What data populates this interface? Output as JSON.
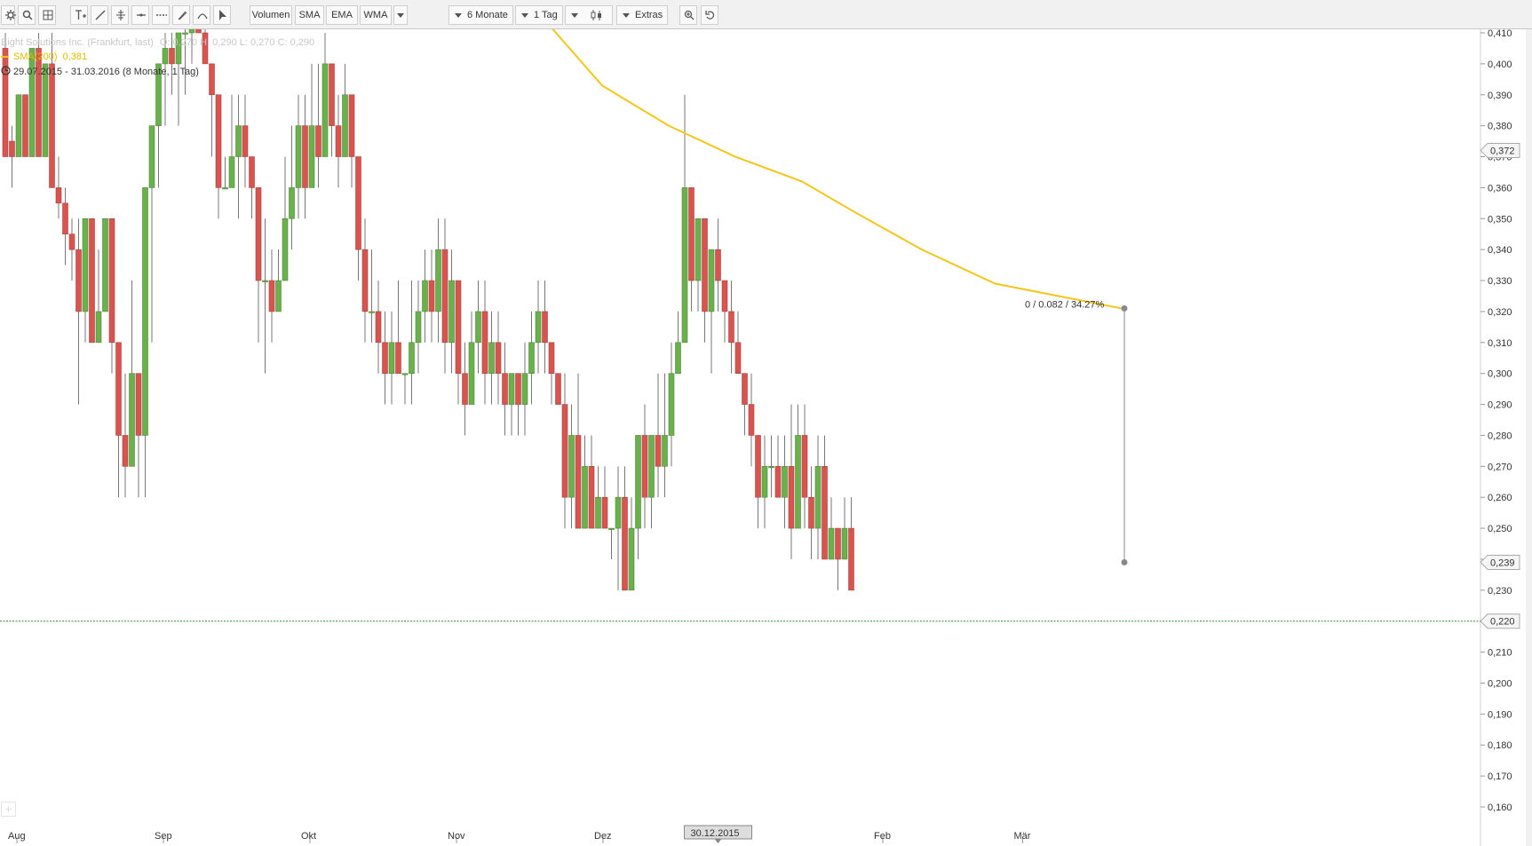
{
  "toolbar": {
    "icons": [
      "settings-icon",
      "search-icon",
      "grid-icon",
      "text-tool-icon",
      "line-tool-icon",
      "crosshair-icon",
      "horizontal-line-icon",
      "dotted-line-icon",
      "pencil-icon",
      "arc-tool-icon",
      "cursor-icon",
      "zoom-icon",
      "undo-icon"
    ],
    "indicator_buttons": [
      "Volumen",
      "SMA",
      "EMA",
      "WMA"
    ],
    "range_label": "6 Monate",
    "interval_label": "1 Tag",
    "extras_label": "Extras"
  },
  "legend": {
    "instrument": "Eight Solutions Inc. (Frankfurt, last)",
    "ohlc": "O: 0,270  H: 0,290  L: 0,270  C: 0,290",
    "sma_label": "SMA(200)",
    "sma_value": "0,381",
    "period": "29.07.2015 - 31.03.2016 (8 Monate, 1 Tag)"
  },
  "colors": {
    "up": "#6ab04c",
    "down": "#d9534f",
    "sma": "#f5c518",
    "baseline": "#2e8b3a",
    "wick": "#777777"
  },
  "chart_data": {
    "type": "candlestick",
    "title": "Eight Solutions Inc. (Frankfurt, last)",
    "ylim": [
      0.16,
      0.415
    ],
    "y_ticks": [
      "0,160",
      "0,170",
      "0,180",
      "0,190",
      "0,200",
      "0,210",
      "0,220",
      "0,230",
      "0,240",
      "0,250",
      "0,260",
      "0,270",
      "0,280",
      "0,290",
      "0,300",
      "0,310",
      "0,320",
      "0,330",
      "0,340",
      "0,350",
      "0,360",
      "0,370",
      "0,380",
      "0,390",
      "0,400",
      "0,410"
    ],
    "x_month_labels": [
      "Aug",
      "Sep",
      "Okt",
      "Nov",
      "Dez",
      "Feb",
      "Mär"
    ],
    "x_month_day_index": [
      0,
      22,
      44,
      66,
      88,
      130,
      151
    ],
    "crosshair_date": "30.12.2015",
    "crosshair_day_index": 107,
    "price_markers": [
      {
        "label": "0,372",
        "value": 0.372
      },
      {
        "label": "0,239",
        "value": 0.239
      },
      {
        "label": "0,220",
        "value": 0.22
      }
    ],
    "horizontal_line": 0.22,
    "measurement": {
      "label": "0 / 0.082 / 34.27%",
      "day_index": 168,
      "from": 0.239,
      "to": 0.321
    },
    "sma200": {
      "name": "SMA(200)",
      "points": [
        [
          79,
          0.42
        ],
        [
          90,
          0.393
        ],
        [
          100,
          0.38
        ],
        [
          110,
          0.37
        ],
        [
          120,
          0.362
        ],
        [
          128,
          0.352
        ],
        [
          138,
          0.34
        ],
        [
          149,
          0.329
        ],
        [
          168,
          0.321
        ]
      ]
    },
    "candles": [
      [
        0,
        0.41,
        0.38,
        0.405
      ],
      [
        0,
        0.39,
        0.36,
        0.37
      ],
      [
        0,
        0.38,
        0.36,
        0.375
      ],
      [
        0,
        0.4,
        0.37,
        0.38
      ],
      [
        0,
        0.39,
        0.37,
        0.39
      ],
      [
        0,
        0.41,
        0.38,
        0.37
      ],
      [
        0,
        0.4,
        0.38,
        0.4
      ],
      [
        0,
        0.39,
        0.36,
        0.36
      ],
      [
        0,
        0.37,
        0.35,
        0.355
      ],
      [
        0,
        0.365,
        0.335,
        0.345
      ],
      [
        0,
        0.35,
        0.33,
        0.34
      ],
      [
        0,
        0.35,
        0.29,
        0.335
      ],
      [
        0,
        0.35,
        0.31,
        0.335
      ],
      [
        0,
        0.35,
        0.31,
        0.32
      ],
      [
        0,
        0.34,
        0.31,
        0.33
      ],
      [
        0,
        0.35,
        0.32,
        0.33
      ],
      [
        0,
        0.32,
        0.3,
        0.31
      ],
      [
        0,
        0.31,
        0.25,
        0.29
      ],
      [
        0,
        0.3,
        0.26,
        0.27
      ],
      [
        0,
        0.33,
        0.29,
        0.3
      ],
      [
        0,
        0.3,
        0.26,
        0.28
      ],
      [
        0,
        0.35,
        0.26,
        0.32
      ],
      [
        0,
        0.36,
        0.31,
        0.36
      ],
      [
        0,
        0.39,
        0.36,
        0.38
      ],
      [
        0,
        0.41,
        0.38,
        0.4
      ],
      [
        0,
        0.405,
        0.39,
        0.4
      ],
      [
        0,
        0.41,
        0.38,
        0.395
      ],
      [
        0,
        0.41,
        0.38,
        0.4
      ],
      [
        0,
        0.41,
        0.39,
        0.41
      ],
      [
        0,
        0.42,
        0.4,
        0.41
      ],
      [
        0,
        0.42,
        0.41,
        0.42
      ],
      [
        0,
        0.42,
        0.41,
        0.41
      ],
      [
        0,
        0.4,
        0.37,
        0.39
      ],
      [
        0,
        0.38,
        0.35,
        0.36
      ],
      [
        0,
        0.37,
        0.36,
        0.36
      ],
      [
        0,
        0.39,
        0.36,
        0.37
      ],
      [
        0,
        0.39,
        0.35,
        0.38
      ],
      [
        0,
        0.39,
        0.36,
        0.37
      ],
      [
        0,
        0.37,
        0.35,
        0.36
      ],
      [
        0,
        0.35,
        0.31,
        0.33
      ],
      [
        0,
        0.35,
        0.3,
        0.33
      ],
      [
        0,
        0.34,
        0.31,
        0.32
      ],
      [
        0,
        0.34,
        0.32,
        0.33
      ],
      [
        0,
        0.37,
        0.33,
        0.35
      ],
      [
        0,
        0.38,
        0.34,
        0.36
      ],
      [
        0,
        0.39,
        0.35,
        0.38
      ],
      [
        0,
        0.39,
        0.35,
        0.36
      ],
      [
        0,
        0.4,
        0.36,
        0.38
      ],
      [
        0,
        0.4,
        0.36,
        0.37
      ],
      [
        0,
        0.41,
        0.37,
        0.4
      ],
      [
        0,
        0.4,
        0.37,
        0.38
      ],
      [
        0,
        0.39,
        0.36,
        0.37
      ],
      [
        0,
        0.4,
        0.37,
        0.39
      ],
      [
        0,
        0.39,
        0.36,
        0.37
      ]
    ]
  }
}
